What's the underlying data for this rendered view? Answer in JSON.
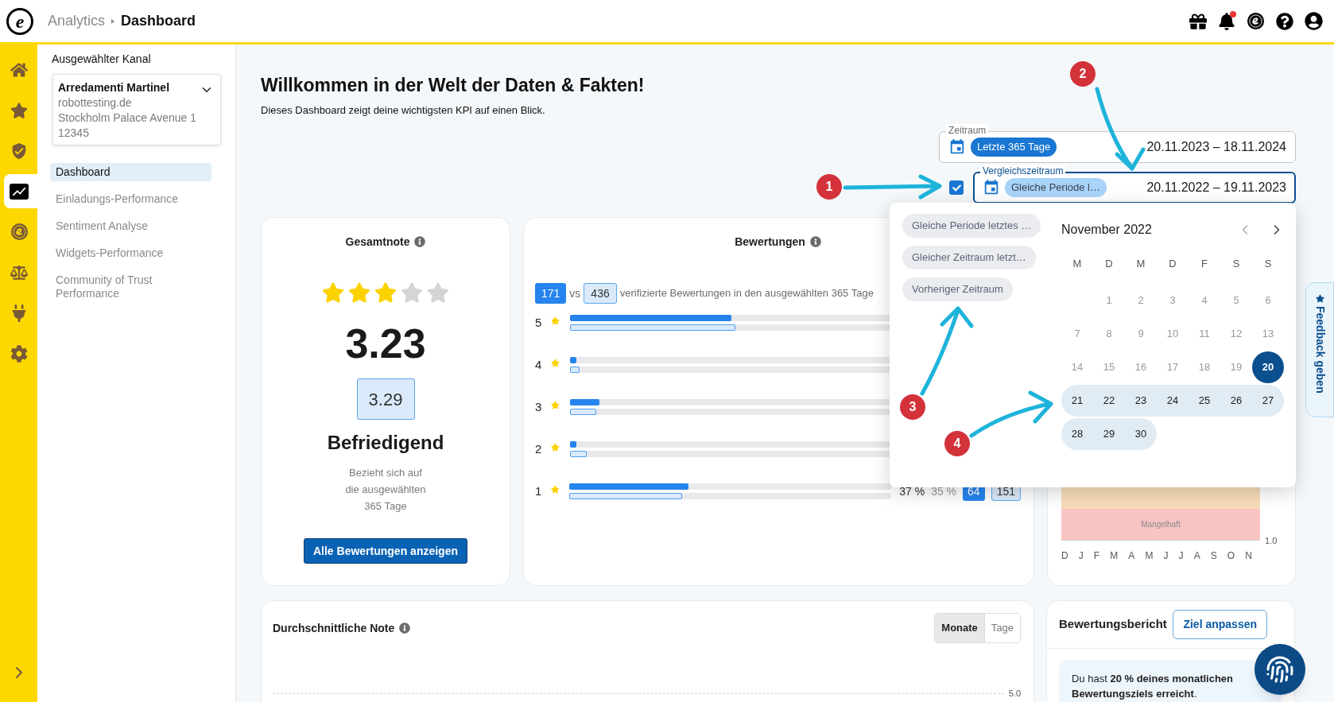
{
  "topbar": {
    "logo": "e",
    "breadcrumb": [
      "Analytics",
      "Dashboard"
    ],
    "notification": true
  },
  "rail": [
    {
      "kind": "home",
      "selected": false
    },
    {
      "kind": "star",
      "selected": false
    },
    {
      "kind": "shield",
      "selected": false
    },
    {
      "kind": "chart",
      "selected": true
    },
    {
      "kind": "coin",
      "selected": false
    },
    {
      "kind": "scale",
      "selected": false
    },
    {
      "kind": "plug",
      "selected": false
    },
    {
      "kind": "gear",
      "selected": false
    }
  ],
  "sidebar": {
    "label": "Ausgewählter Kanal",
    "channel": {
      "name": "Arredamenti Martinel",
      "lines": [
        "robottesting.de",
        "Stockholm Palace Avenue 1",
        "12345"
      ]
    },
    "items": [
      {
        "label": "Dashboard",
        "selected": true
      },
      {
        "label": "Einladungs-Performance",
        "selected": false
      },
      {
        "label": "Sentiment Analyse",
        "selected": false
      },
      {
        "label": "Widgets-Performance",
        "selected": false
      },
      {
        "label": "Community of Trust Performance",
        "selected": false
      }
    ]
  },
  "page": {
    "title": "Willkommen in der Welt der Daten & Fakten!",
    "subtitle": "Dieses Dashboard zeigt deine wichtigsten KPI auf einen Blick."
  },
  "period": {
    "label": "Zeitraum",
    "chip": "Letzte 365 Tage",
    "range": "20.11.2023 – 18.11.2024"
  },
  "comparison": {
    "checked": true,
    "label": "Vergleichszeitraum",
    "chip": "Gleiche Periode l…",
    "range": "20.11.2022 – 19.11.2023"
  },
  "popover": {
    "shortcuts": [
      "Gleiche Periode letztes …",
      "Gleicher Zeitraum letzt…",
      "Vorheriger Zeitraum"
    ],
    "month": "November 2022",
    "weekdays": [
      "M",
      "D",
      "M",
      "D",
      "F",
      "S",
      "S"
    ],
    "weeks": [
      {
        "days": [
          {
            "day": "1",
            "selected": false,
            "in_range": false
          },
          {
            "day": "2",
            "selected": false,
            "in_range": false
          },
          {
            "day": "3",
            "selected": false,
            "in_range": false
          },
          {
            "day": "4",
            "selected": false,
            "in_range": false
          },
          {
            "day": "5",
            "selected": false,
            "in_range": false
          },
          {
            "day": "6",
            "selected": false,
            "in_range": false
          }
        ]
      },
      {
        "days": [
          {
            "day": "7",
            "selected": false,
            "in_range": false
          },
          {
            "day": "8",
            "selected": false,
            "in_range": false
          },
          {
            "day": "9",
            "selected": false,
            "in_range": false
          },
          {
            "day": "10",
            "selected": false,
            "in_range": false
          },
          {
            "day": "11",
            "selected": false,
            "in_range": false
          },
          {
            "day": "12",
            "selected": false,
            "in_range": false
          },
          {
            "day": "13",
            "selected": false,
            "in_range": false
          }
        ]
      },
      {
        "days": [
          {
            "day": "14",
            "selected": false,
            "in_range": false
          },
          {
            "day": "15",
            "selected": false,
            "in_range": false
          },
          {
            "day": "16",
            "selected": false,
            "in_range": false
          },
          {
            "day": "17",
            "selected": false,
            "in_range": false
          },
          {
            "day": "18",
            "selected": false,
            "in_range": false
          },
          {
            "day": "19",
            "selected": false,
            "in_range": false
          },
          {
            "day": "20",
            "selected": true,
            "in_range": false
          }
        ]
      },
      {
        "days": [
          {
            "day": "21",
            "selected": false,
            "in_range": true
          },
          {
            "day": "22",
            "selected": false,
            "in_range": true
          },
          {
            "day": "23",
            "selected": false,
            "in_range": true
          },
          {
            "day": "24",
            "selected": false,
            "in_range": true
          },
          {
            "day": "25",
            "selected": false,
            "in_range": true
          },
          {
            "day": "26",
            "selected": false,
            "in_range": true
          },
          {
            "day": "27",
            "selected": false,
            "in_range": true
          }
        ]
      },
      {
        "days": [
          {
            "day": "28",
            "selected": false,
            "in_range": true
          },
          {
            "day": "29",
            "selected": false,
            "in_range": true
          },
          {
            "day": "30",
            "selected": false,
            "in_range": true
          }
        ]
      }
    ]
  },
  "overall": {
    "title": "Gesamtnote",
    "stars": 3,
    "score": "3.23",
    "compare_score": "3.29",
    "verdict": "Befriedigend",
    "note": "Bezieht sich auf die ausgewählten 365 Tage",
    "button": "Alle Bewertungen anzeigen"
  },
  "reviews": {
    "title": "Bewertungen",
    "count": "171",
    "vs": "vs",
    "compare_count": "436",
    "caption": "verifizierte Bewertungen in den ausgewählten 365 Tage",
    "rows": [
      {
        "label": "5",
        "bars": [
          {
            "kind": "current",
            "level": 0.49
          },
          {
            "kind": "compare",
            "level": 0.5
          }
        ]
      },
      {
        "label": "4",
        "bars": [
          {
            "kind": "current",
            "level": 0.02
          },
          {
            "kind": "compare",
            "level": 0.03
          }
        ]
      },
      {
        "label": "3",
        "bars": [
          {
            "kind": "current",
            "level": 0.09
          },
          {
            "kind": "compare",
            "level": 0.08
          }
        ]
      },
      {
        "label": "2",
        "bars": [
          {
            "kind": "current",
            "level": 0.02
          },
          {
            "kind": "compare",
            "level": 0.05
          }
        ]
      },
      {
        "label": "1",
        "bars": [
          {
            "kind": "current",
            "level": 0.37
          },
          {
            "kind": "compare",
            "level": 0.35
          }
        ],
        "figures": [
          {
            "kind": "percent",
            "text": "37 %"
          },
          {
            "kind": "compare_percent",
            "text": "35 %"
          },
          {
            "kind": "count",
            "text": "64"
          },
          {
            "kind": "compare_count",
            "text": "151"
          }
        ]
      }
    ]
  },
  "trend": {
    "band_label": "Mangelhaft",
    "tick": "1.0",
    "months": [
      "D",
      "J",
      "F",
      "M",
      "A",
      "M",
      "J",
      "J",
      "A",
      "S",
      "O",
      "N"
    ]
  },
  "average": {
    "title": "Durchschnittliche Note",
    "toggle": [
      {
        "label": "Monate",
        "selected": true
      },
      {
        "label": "Tage",
        "selected": false
      }
    ],
    "tick": "5.0"
  },
  "report": {
    "title": "Bewertungsbericht",
    "button": "Ziel anpassen",
    "message": "Du hast **20 % deines monatlichen Bewertungsziels erreicht**."
  },
  "feedback": {
    "label": "Feedback geben"
  },
  "annotations": [
    {
      "label": "1"
    },
    {
      "label": "2"
    },
    {
      "label": "3"
    },
    {
      "label": "4"
    }
  ]
}
